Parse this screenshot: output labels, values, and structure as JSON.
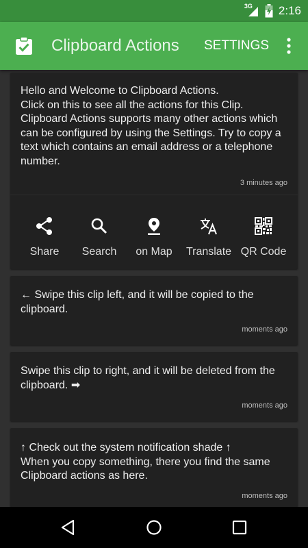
{
  "status_bar": {
    "network": "3G",
    "time": "2:16"
  },
  "app_bar": {
    "title": "Clipboard Actions",
    "settings_label": "SETTINGS"
  },
  "clips": [
    {
      "text": "Hello and Welcome to Clipboard Actions.\nClick on this to see all the actions for this Clip.\nClipboard Actions supports many other actions which can be configured by using the Settings. Try to copy a text which contains an email address or a telephone number.",
      "time": "3 minutes ago"
    },
    {
      "text": "← Swipe this clip left, and it will be copied to the clipboard.",
      "time": "moments ago"
    },
    {
      "text": "Swipe this clip to right, and it will be deleted from the clipboard. ➡",
      "time": "moments ago"
    },
    {
      "text": "↑ Check out the system notification shade ↑\nWhen you copy something, there you find the same Clipboard actions as here.",
      "time": "moments ago"
    }
  ],
  "actions": [
    {
      "label": "Share",
      "icon": "share-icon"
    },
    {
      "label": "Search",
      "icon": "search-icon"
    },
    {
      "label": "on Map",
      "icon": "map-pin-icon"
    },
    {
      "label": "Translate",
      "icon": "translate-icon"
    },
    {
      "label": "QR Code",
      "icon": "qr-code-icon"
    }
  ],
  "colors": {
    "primary": "#4caf50",
    "primary_dark": "#388e3c",
    "background": "#303030",
    "card": "#212121"
  }
}
